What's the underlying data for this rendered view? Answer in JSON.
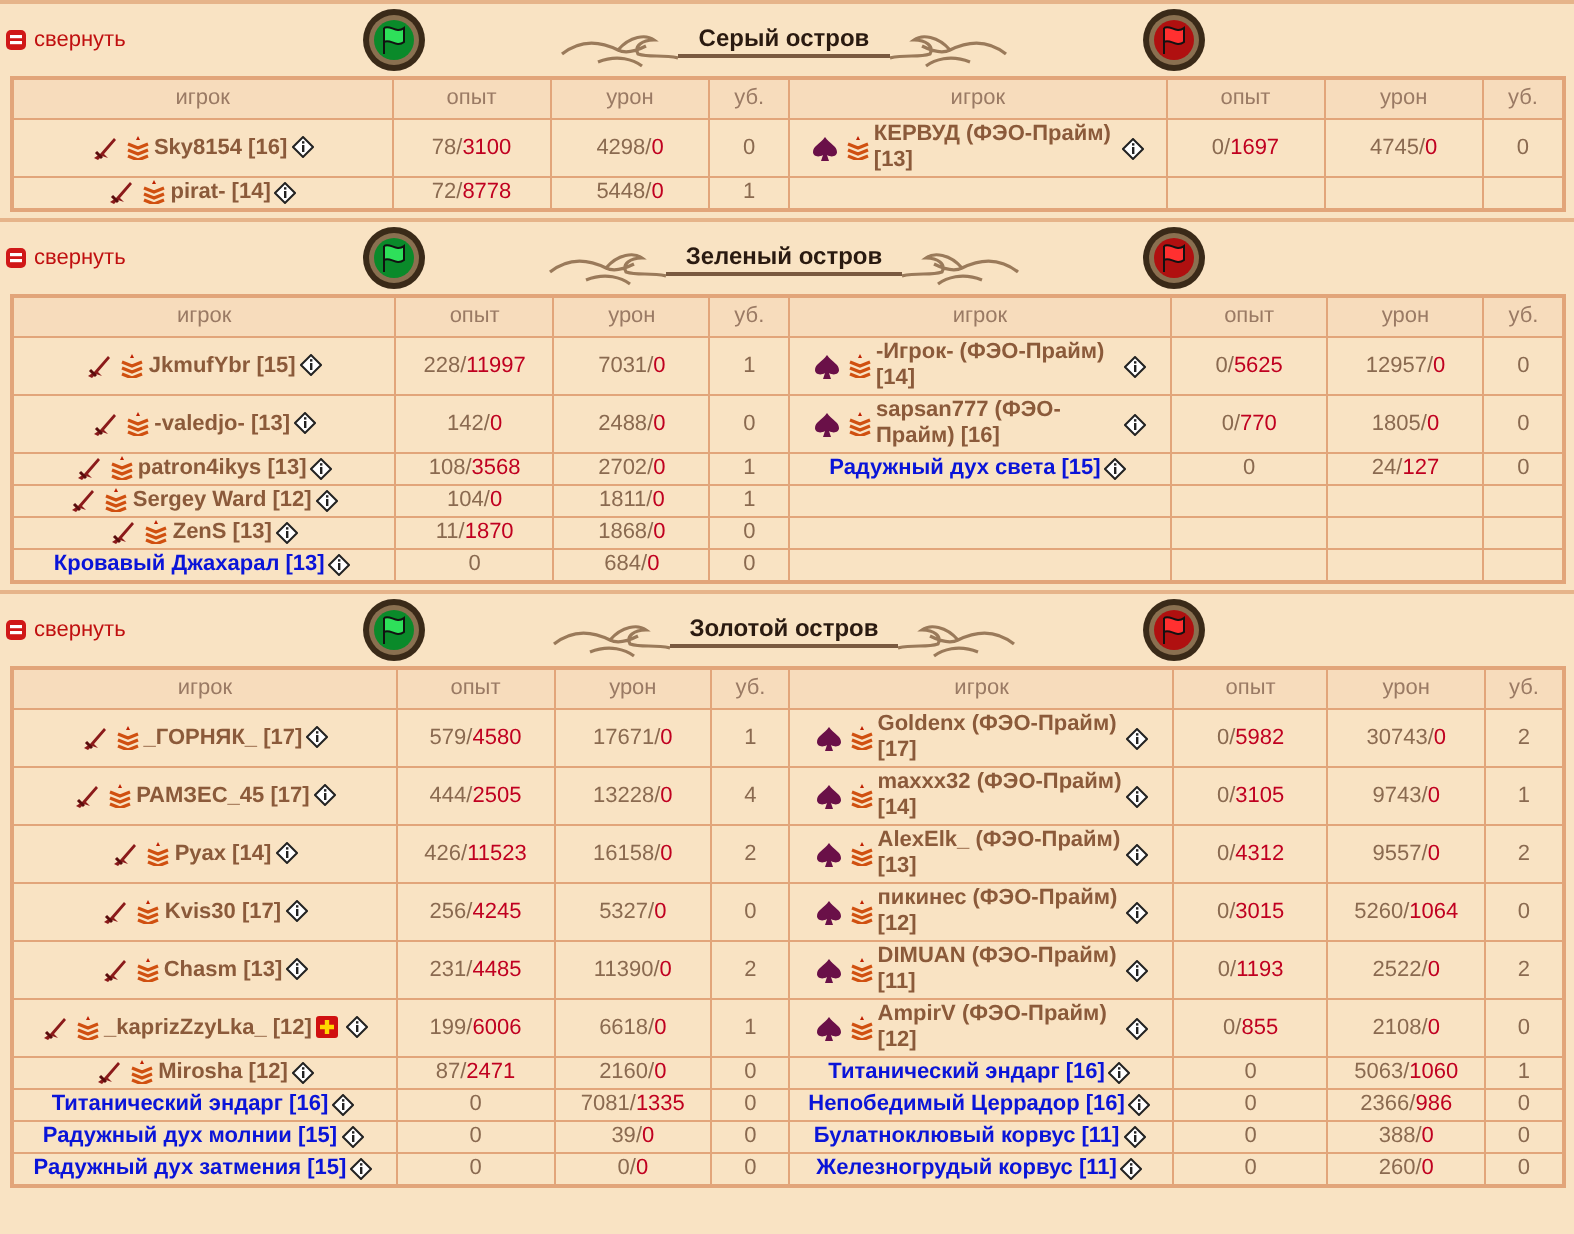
{
  "sections": [
    {
      "collapse": "свернуть",
      "title": "Серый остров",
      "left": {
        "columns": [
          "игрок",
          "опыт",
          "урон",
          "уб."
        ],
        "rows": [
          {
            "kind": "player",
            "name": "Sky8154 [16]",
            "exp": "78/3100",
            "damage": "4298/0",
            "kills": "0"
          },
          {
            "kind": "player",
            "name": "pirat- [14]",
            "exp": "72/8778",
            "damage": "5448/0",
            "kills": "1"
          }
        ]
      },
      "right": {
        "columns": [
          "игрок",
          "опыт",
          "урон",
          "уб."
        ],
        "rows": [
          {
            "kind": "player",
            "name": "КЕРВУД (ФЭО-Прайм) [13]",
            "exp": "0/1697",
            "damage": "4745/0",
            "kills": "0"
          }
        ]
      }
    },
    {
      "collapse": "свернуть",
      "title": "Зеленый остров",
      "left": {
        "columns": [
          "игрок",
          "опыт",
          "урон",
          "уб."
        ],
        "rows": [
          {
            "kind": "player",
            "name": "JkmufYbr [15]",
            "exp": "228/11997",
            "damage": "7031/0",
            "kills": "1"
          },
          {
            "kind": "player",
            "name": "-valedjo- [13]",
            "exp": "142/0",
            "damage": "2488/0",
            "kills": "0"
          },
          {
            "kind": "player",
            "name": "patron4ikys [13]",
            "exp": "108/3568",
            "damage": "2702/0",
            "kills": "1"
          },
          {
            "kind": "player",
            "name": "Sergey Ward [12]",
            "exp": "104/0",
            "damage": "1811/0",
            "kills": "1"
          },
          {
            "kind": "player",
            "name": "ZenS [13]",
            "exp": "11/1870",
            "damage": "1868/0",
            "kills": "0"
          },
          {
            "kind": "monster",
            "name": "Кровавый Джахарал [13]",
            "exp": "0",
            "damage": "684/0",
            "kills": "0"
          }
        ]
      },
      "right": {
        "columns": [
          "игрок",
          "опыт",
          "урон",
          "уб."
        ],
        "rows": [
          {
            "kind": "player",
            "name": "-Игрок- (ФЭО-Прайм) [14]",
            "exp": "0/5625",
            "damage": "12957/0",
            "kills": "0"
          },
          {
            "kind": "player",
            "name": "sapsan777 (ФЭО-Прайм) [16]",
            "exp": "0/770",
            "damage": "1805/0",
            "kills": "0"
          },
          {
            "kind": "monster",
            "name": "Радужный дух света  [15]",
            "exp": "0",
            "damage": "24/127",
            "kills": "0"
          }
        ]
      }
    },
    {
      "collapse": "свернуть",
      "title": "Золотой остров",
      "left": {
        "columns": [
          "игрок",
          "опыт",
          "урон",
          "уб."
        ],
        "rows": [
          {
            "kind": "player",
            "name": "_ГОРНЯК_ [17]",
            "exp": "579/4580",
            "damage": "17671/0",
            "kills": "1"
          },
          {
            "kind": "player",
            "name": "РАМЗЕС_45 [17]",
            "exp": "444/2505",
            "damage": "13228/0",
            "kills": "4"
          },
          {
            "kind": "player",
            "name": "Pyax [14]",
            "exp": "426/11523",
            "damage": "16158/0",
            "kills": "2"
          },
          {
            "kind": "player",
            "name": "Kvis30 [17]",
            "exp": "256/4245",
            "damage": "5327/0",
            "kills": "0"
          },
          {
            "kind": "player",
            "name": "Chasm [13]",
            "exp": "231/4485",
            "damage": "11390/0",
            "kills": "2"
          },
          {
            "kind": "player",
            "name": "_kaprizZzyLka_ [12]",
            "exp": "199/6006",
            "damage": "6618/0",
            "kills": "1",
            "cross": true
          },
          {
            "kind": "player",
            "name": "Mirosha [12]",
            "exp": "87/2471",
            "damage": "2160/0",
            "kills": "0"
          },
          {
            "kind": "monster",
            "name": "Титанический эндарг [16]",
            "exp": "0",
            "damage": "7081/1335",
            "kills": "0"
          },
          {
            "kind": "monster",
            "name": "Радужный дух молнии  [15]",
            "exp": "0",
            "damage": "39/0",
            "kills": "0"
          },
          {
            "kind": "monster",
            "name": "Радужный дух затмения  [15]",
            "exp": "0",
            "damage": "0/0",
            "kills": "0"
          }
        ]
      },
      "right": {
        "columns": [
          "игрок",
          "опыт",
          "урон",
          "уб."
        ],
        "rows": [
          {
            "kind": "player",
            "name": "Goldenx (ФЭО-Прайм) [17]",
            "exp": "0/5982",
            "damage": "30743/0",
            "kills": "2"
          },
          {
            "kind": "player",
            "name": "maxxx32 (ФЭО-Прайм) [14]",
            "exp": "0/3105",
            "damage": "9743/0",
            "kills": "1"
          },
          {
            "kind": "player",
            "name": "AlexElk_ (ФЭО-Прайм) [13]",
            "exp": "0/4312",
            "damage": "9557/0",
            "kills": "2"
          },
          {
            "kind": "player",
            "name": "пикинес (ФЭО-Прайм) [12]",
            "exp": "0/3015",
            "damage": "5260/1064",
            "kills": "0"
          },
          {
            "kind": "player",
            "name": "DIMUAN (ФЭО-Прайм) [11]",
            "exp": "0/1193",
            "damage": "2522/0",
            "kills": "2"
          },
          {
            "kind": "player",
            "name": "AmpirV (ФЭО-Прайм) [12]",
            "exp": "0/855",
            "damage": "2108/0",
            "kills": "0"
          },
          {
            "kind": "monster",
            "name": "Титанический эндарг [16]",
            "exp": "0",
            "damage": "5063/1060",
            "kills": "1"
          },
          {
            "kind": "monster",
            "name": "Непобедимый Церрадор [16]",
            "exp": "0",
            "damage": "2366/986",
            "kills": "0"
          },
          {
            "kind": "monster",
            "name": "Булатноклювый корвус [11]",
            "exp": "0",
            "damage": "388/0",
            "kills": "0"
          },
          {
            "kind": "monster",
            "name": "Железногрудый корвус  [11]",
            "exp": "0",
            "damage": "260/0",
            "kills": "0"
          }
        ]
      }
    }
  ]
}
